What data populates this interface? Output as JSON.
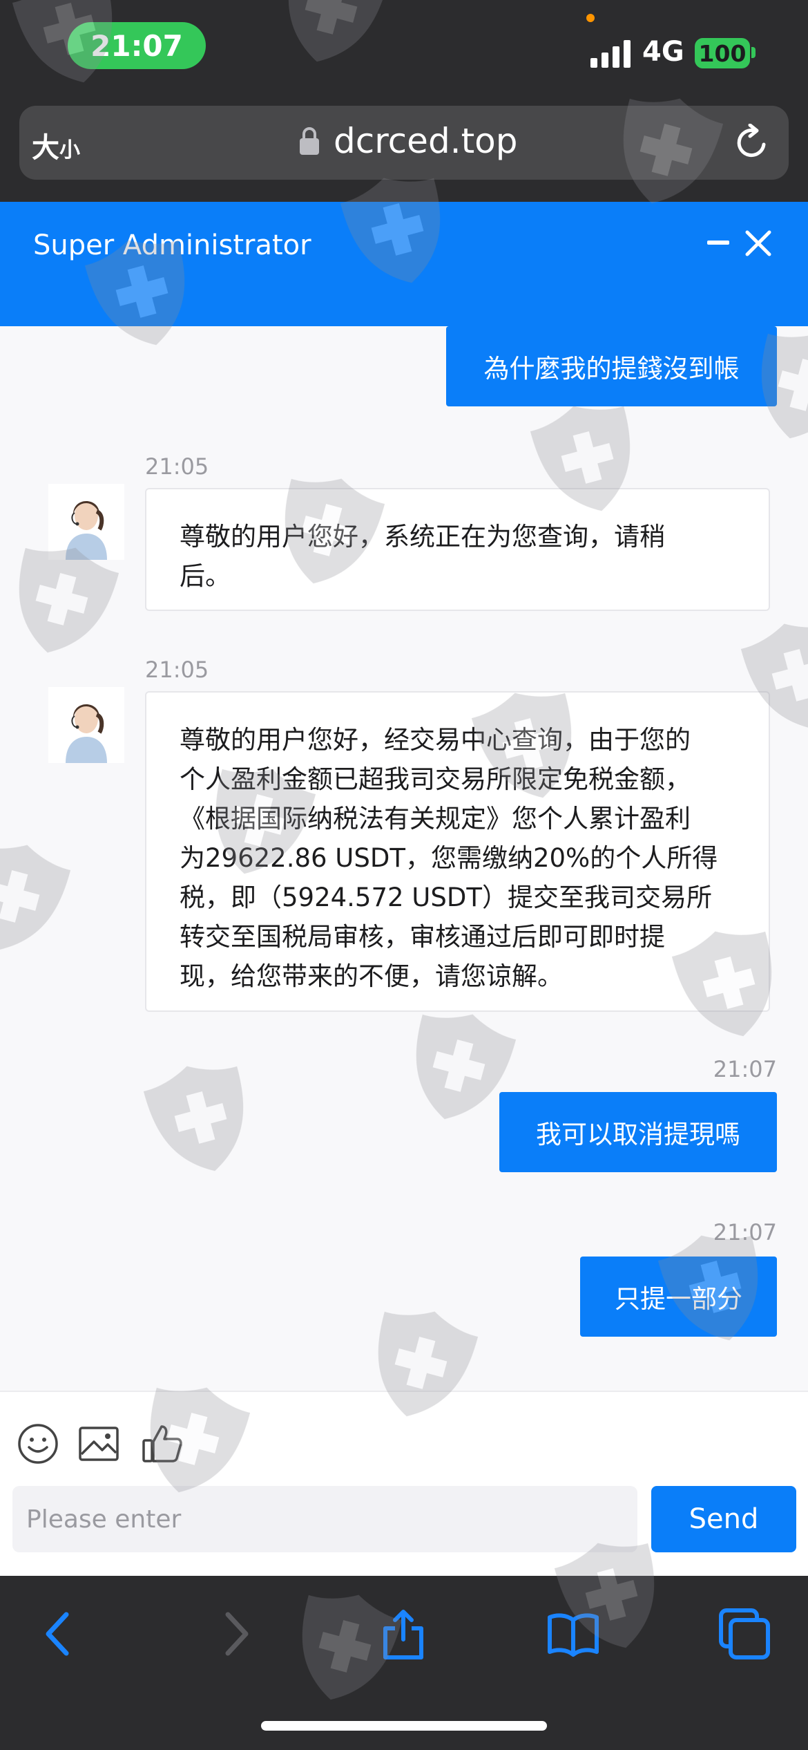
{
  "status_bar": {
    "time": "21:07",
    "network": "4G",
    "battery": "100"
  },
  "url_bar": {
    "text_size_big": "大",
    "text_size_small": "小",
    "domain": "dcrced.top"
  },
  "chat_header": {
    "title": "Super Administrator"
  },
  "messages": [
    {
      "side": "out",
      "text": "為什麼我的提錢沒到帳"
    },
    {
      "side": "in",
      "time": "21:05",
      "lines": [
        "尊敬的用户您好，系统正在为您查询，请稍",
        "后。"
      ]
    },
    {
      "side": "in",
      "time": "21:05",
      "lines": [
        "尊敬的用户您好，经交易中心查询，由于您的",
        "个人盈利金额已超我司交易所限定免税金额，",
        "《根据国际纳税法有关规定》您个人累计盈利",
        "为29622.86 USDT，您需缴纳20%的个人所得",
        "税，即（5924.572 USDT）提交至我司交易所",
        "转交至国税局审核，审核通过后即可即时提",
        "现，给您带来的不便，请您谅解。"
      ]
    },
    {
      "side": "out",
      "time": "21:07",
      "text": "我可以取消提現嗎"
    },
    {
      "side": "out",
      "time": "21:07",
      "text": "只提一部分"
    }
  ],
  "composer": {
    "placeholder": "Please enter",
    "send_label": "Send"
  },
  "colors": {
    "brand_blue": "#0a7ef9",
    "status_green": "#34c759",
    "chrome_dark": "#2c2c2e"
  },
  "icons": [
    "signal-icon",
    "lock-icon",
    "reload-icon",
    "minimize-icon",
    "close-icon",
    "emoji-icon",
    "image-icon",
    "thumbs-up-icon",
    "back-icon",
    "forward-icon",
    "share-icon",
    "bookmarks-icon",
    "tabs-icon",
    "shield-watermark-icon"
  ]
}
